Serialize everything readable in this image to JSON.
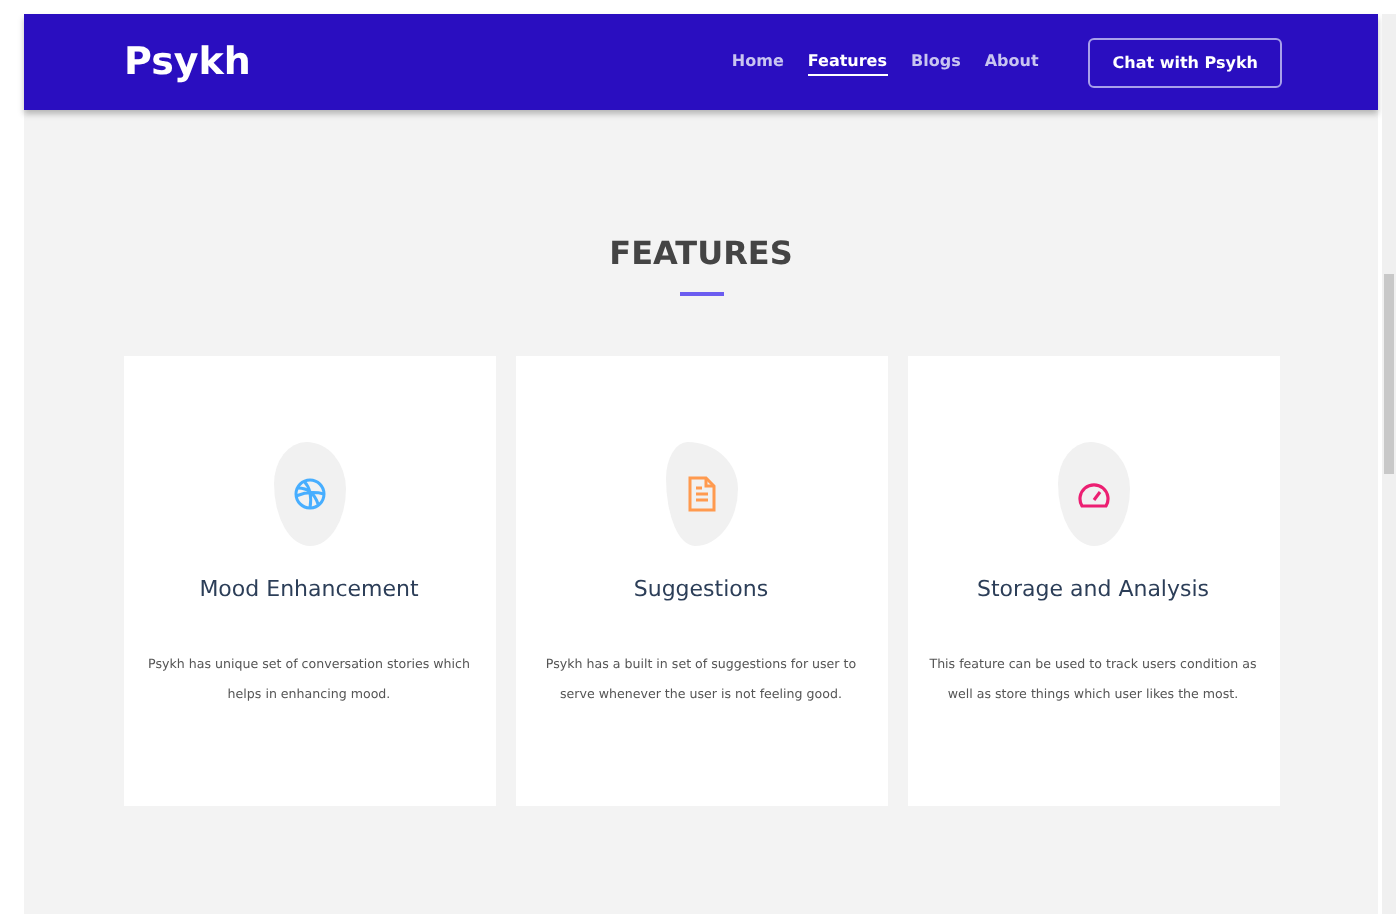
{
  "navbar": {
    "brand": "Psykh",
    "links": [
      {
        "label": "Home",
        "selected": false
      },
      {
        "label": "Features",
        "selected": true
      },
      {
        "label": "Blogs",
        "selected": false
      },
      {
        "label": "About",
        "selected": false
      }
    ],
    "cta": "Chat with Psykh"
  },
  "section": {
    "title": "FEATURES",
    "cards": [
      {
        "kind": "ball",
        "color": "#47aeff",
        "title": "Mood Enhancement",
        "text": "Psykh has unique set of conversation stories which helps in enhancing mood."
      },
      {
        "kind": "document",
        "color": "#ff9a4f",
        "title": "Suggestions",
        "text": "Psykh has a built in set of suggestions for user to serve whenever the user is not feeling good."
      },
      {
        "kind": "gauge",
        "color": "#ec1f72",
        "title": "Storage and Analysis",
        "text": "This feature can be used to track users condition as well as store things which user likes the most."
      }
    ]
  }
}
